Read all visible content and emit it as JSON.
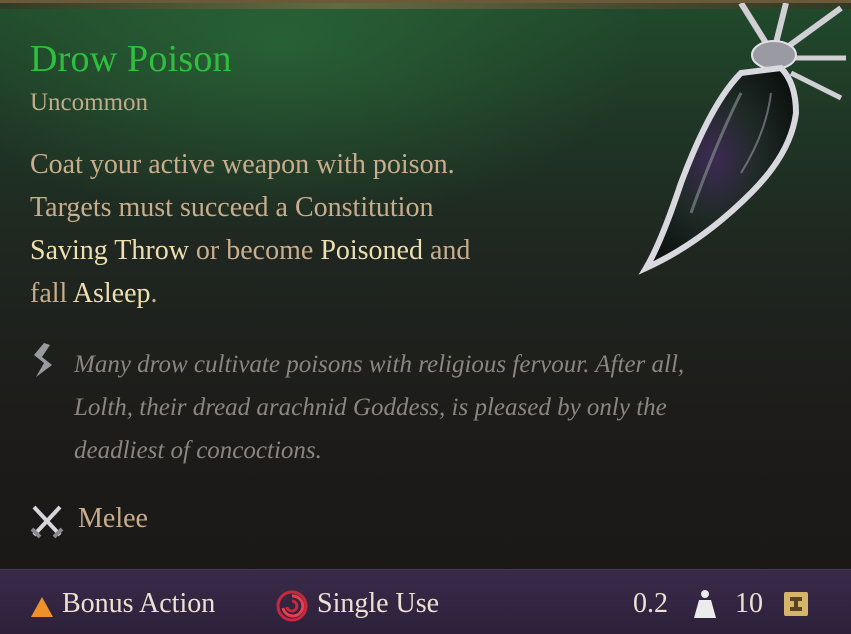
{
  "item": {
    "name": "Drow Poison",
    "rarity": "Uncommon",
    "description": {
      "line1": "Coat your active weapon with poison.",
      "line2": "Targets must succeed a Constitution",
      "saving_throw": "Saving Throw",
      "or_become": " or become ",
      "poisoned": "Poisoned",
      "and": " and",
      "fall": "fall ",
      "asleep": "Asleep",
      "period": "."
    },
    "flavor": {
      "line1": "Many drow cultivate poisons with religious fervour. After all,",
      "line2": "Lolth, their dread arachnid Goddess, is pleased by only the",
      "line3": "deadliest of concoctions."
    },
    "attack_type": "Melee"
  },
  "footer": {
    "action": "Bonus Action",
    "uses": "Single Use",
    "weight": "0.2",
    "price": "10"
  },
  "icons": {
    "flavor": "quote-mark-icon",
    "attack": "crossed-swords-icon",
    "action": "triangle-bonus-action-icon",
    "uses": "spiral-single-use-icon",
    "weight": "weight-icon",
    "price": "gold-coin-icon",
    "item_art": "poison-vial-icon"
  },
  "colors": {
    "title": "#2fbf3f",
    "keyword": "#efdfb0",
    "body": "#c9ad8c",
    "flavor": "#8c8680",
    "footer_bg": "#2c2039"
  }
}
